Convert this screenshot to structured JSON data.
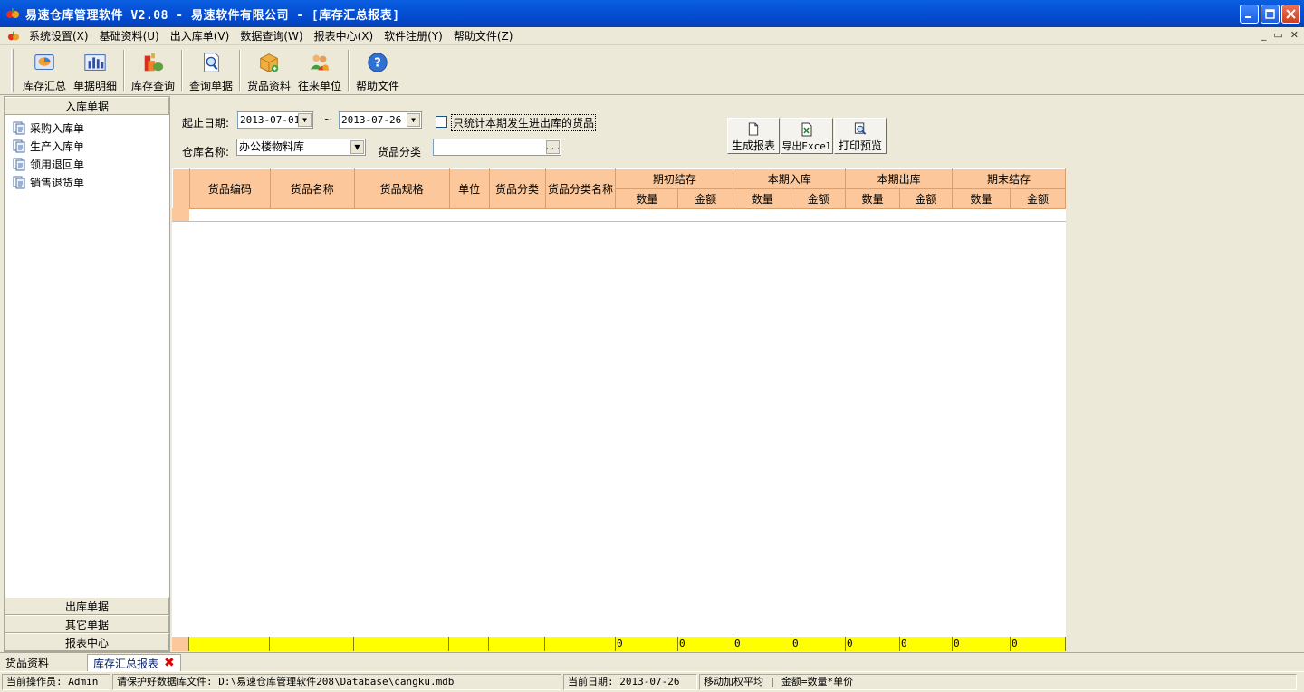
{
  "window": {
    "title": "易速仓库管理软件 V2.08 - 易速软件有限公司 - [库存汇总报表]"
  },
  "menu": [
    "系统设置(X)",
    "基础资料(U)",
    "出入库单(V)",
    "数据查询(W)",
    "报表中心(X)",
    "软件注册(Y)",
    "帮助文件(Z)"
  ],
  "toolbar": {
    "inventory_summary": "库存汇总",
    "doc_detail": "单据明细",
    "stock_query": "库存查询",
    "query_doc": "查询单据",
    "goods_data": "货品资料",
    "partners": "往来单位",
    "help": "帮助文件"
  },
  "leftpanel": {
    "header": "入库单据",
    "items": [
      "采购入库单",
      "生产入库单",
      "领用退回单",
      "销售退货单"
    ],
    "bottom_headers": [
      "出库单据",
      "其它单据",
      "报表中心"
    ]
  },
  "filter": {
    "date_label": "起止日期:",
    "date_from": "2013-07-01",
    "tilde": "~",
    "date_to": "2013-07-26",
    "only_moved_label": "只统计本期发生进出库的货品",
    "warehouse_label": "仓库名称:",
    "warehouse_value": "办公楼物料库",
    "category_label": "货品分类",
    "category_value": "",
    "ellipsis": "...",
    "generate_label": "生成报表",
    "export_label": "导出Excel",
    "print_label": "打印预览"
  },
  "grid": {
    "columns": [
      "货品编码",
      "货品名称",
      "货品规格",
      "单位",
      "货品分类",
      "货品分类名称"
    ],
    "groups": [
      "期初结存",
      "本期入库",
      "本期出库",
      "期末结存"
    ],
    "sub_qty": "数量",
    "sub_amt": "金额",
    "totals": [
      "0",
      "0",
      "0",
      "0",
      "0",
      "0",
      "0",
      "0"
    ]
  },
  "tabs": {
    "goods": "货品资料",
    "report": "库存汇总报表"
  },
  "status": {
    "operator": "当前操作员: Admin",
    "db": "请保护好数据库文件: D:\\易速仓库管理软件208\\Database\\cangku.mdb",
    "date": "当前日期: 2013-07-26",
    "method": "移动加权平均 | 金额=数量*单价"
  }
}
